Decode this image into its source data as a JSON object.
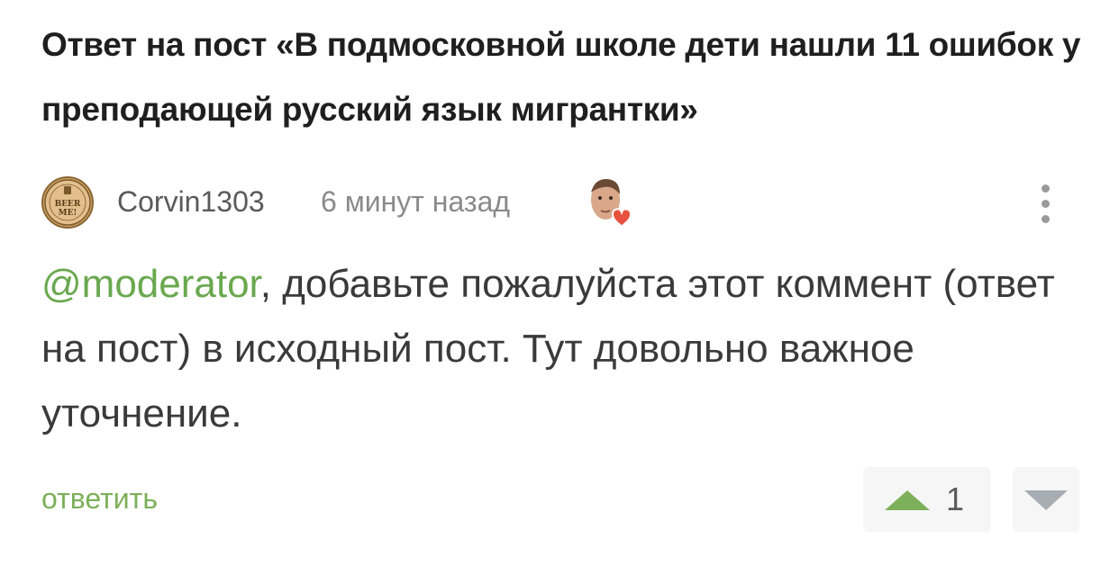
{
  "post": {
    "title": "Ответ на пост «В подмосковной школе дети нашли 11 ошибок у преподающей русский язык мигрантки»"
  },
  "comment": {
    "author": "Corvin1303",
    "timestamp": "6 минут назад",
    "avatar_icon": "beer-me-badge-icon",
    "avatar_text": "BEER ME!",
    "mention": "@moderator",
    "text": ", добавьте пожалуйста этот коммент (ответ на пост) в исходный пост. Тут довольно важное уточнение.",
    "reply_label": "ответить",
    "rating": "1"
  },
  "colors": {
    "accent_green": "#7cb05a",
    "mention_green": "#6aa84f",
    "heart_red": "#e8523f",
    "text_dark": "#1f1f1f",
    "text_muted": "#8a8a8a"
  }
}
